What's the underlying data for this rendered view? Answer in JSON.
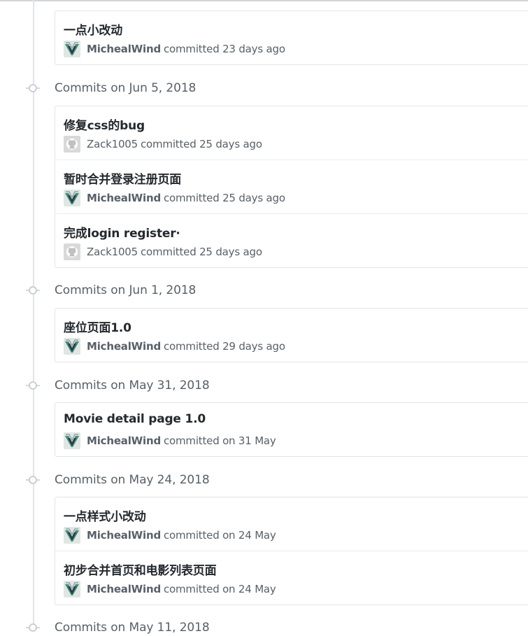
{
  "groups": [
    {
      "title": "",
      "commits": [
        {
          "message": "一点小改动",
          "author": "MichealWind",
          "avatar_icon": "micheal-avatar-icon",
          "action": "committed 23 days ago"
        }
      ]
    },
    {
      "title": "Commits on Jun 5, 2018",
      "commits": [
        {
          "message": "修复css的bug",
          "author": "Zack1005",
          "avatar_icon": "github-default-avatar-icon",
          "action": "committed 25 days ago"
        },
        {
          "message": "暂时合并登录注册页面",
          "author": "MichealWind",
          "avatar_icon": "micheal-avatar-icon",
          "action": "committed 25 days ago"
        },
        {
          "message": "完成login register·",
          "author": "Zack1005",
          "avatar_icon": "github-default-avatar-icon",
          "action": "committed 25 days ago"
        }
      ]
    },
    {
      "title": "Commits on Jun 1, 2018",
      "commits": [
        {
          "message": "座位页面1.0",
          "author": "MichealWind",
          "avatar_icon": "micheal-avatar-icon",
          "action": "committed 29 days ago"
        }
      ]
    },
    {
      "title": "Commits on May 31, 2018",
      "commits": [
        {
          "message": "Movie detail page 1.0",
          "author": "MichealWind",
          "avatar_icon": "micheal-avatar-icon",
          "action": "committed on 31 May"
        }
      ]
    },
    {
      "title": "Commits on May 24, 2018",
      "commits": [
        {
          "message": "一点样式小改动",
          "author": "MichealWind",
          "avatar_icon": "micheal-avatar-icon",
          "action": "committed on 24 May"
        },
        {
          "message": "初步合并首页和电影列表页面",
          "author": "MichealWind",
          "avatar_icon": "micheal-avatar-icon",
          "action": "committed on 24 May"
        }
      ]
    },
    {
      "title": "Commits on May 11, 2018",
      "commits": []
    }
  ],
  "colors": {
    "text_primary": "#24292e",
    "text_muted": "#586069",
    "border": "#e1e4e8",
    "timeline": "#e1e4e8"
  }
}
